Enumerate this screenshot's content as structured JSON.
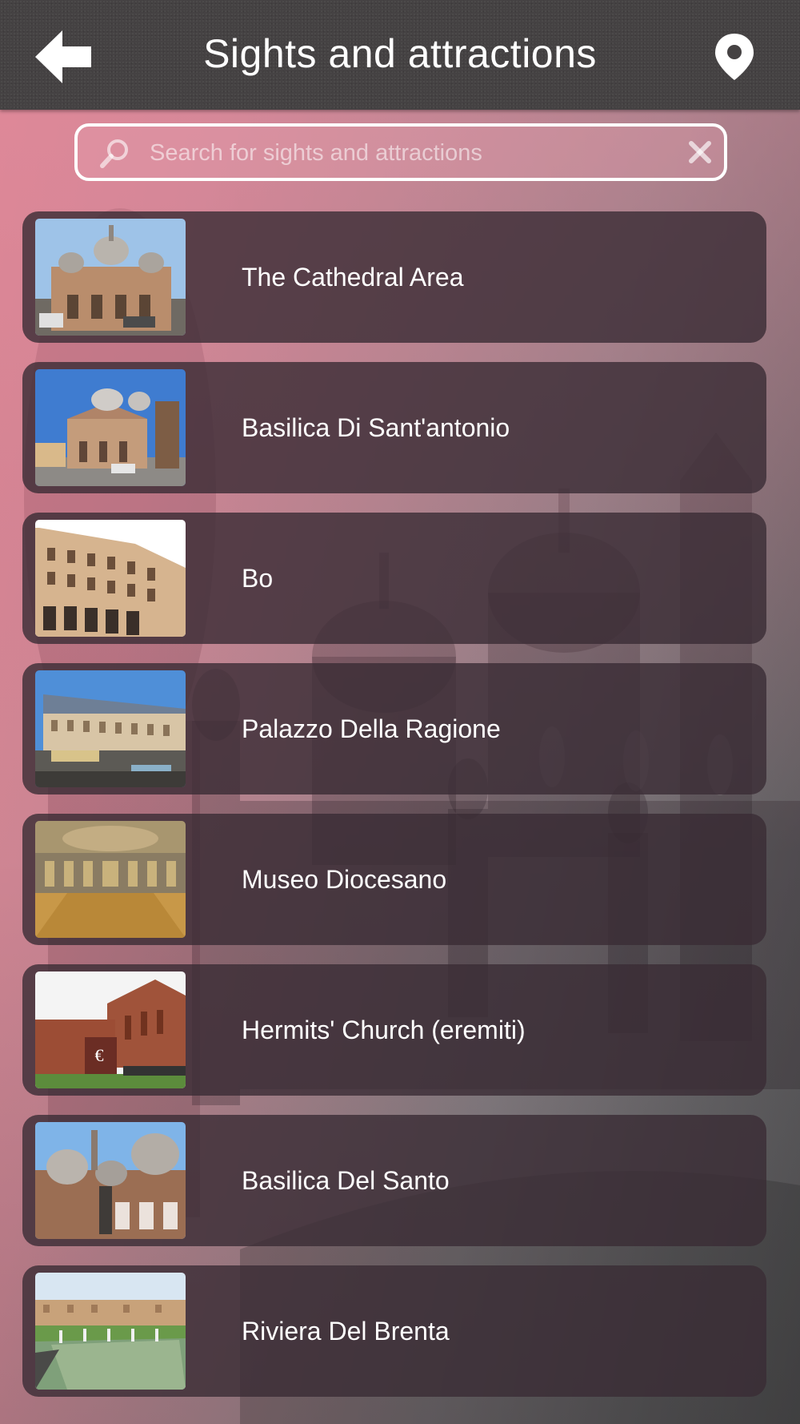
{
  "header": {
    "title": "Sights and attractions",
    "back_icon": "back-arrow-icon",
    "map_icon": "map-pin-icon"
  },
  "search": {
    "placeholder": "Search for sights and attractions",
    "value": "",
    "search_icon": "magnifier-icon",
    "clear_icon": "clear-x-icon"
  },
  "attractions": [
    {
      "label": "The Cathedral Area"
    },
    {
      "label": "Basilica Di Sant'antonio"
    },
    {
      "label": "Bo"
    },
    {
      "label": "Palazzo Della Ragione"
    },
    {
      "label": "Museo Diocesano"
    },
    {
      "label": "Hermits' Church (eremiti)"
    },
    {
      "label": "Basilica Del Santo"
    },
    {
      "label": "Riviera Del Brenta"
    }
  ],
  "colors": {
    "header_bg": "#454243",
    "card_bg": "rgba(58,44,52,0.80)",
    "text": "#ffffff",
    "background_tint": "#d98592"
  }
}
